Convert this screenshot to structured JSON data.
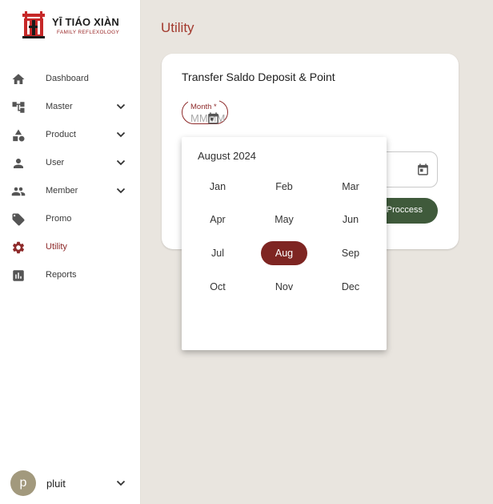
{
  "brand": {
    "name": "YĪ TIÁO XIÀN",
    "tagline": "FAMILY REFLEXOLOGY",
    "color": "#c62828"
  },
  "sidebar": {
    "items": [
      {
        "label": "Dashboard",
        "icon": "home-icon",
        "expandable": false
      },
      {
        "label": "Master",
        "icon": "hierarchy-icon",
        "expandable": true
      },
      {
        "label": "Product",
        "icon": "shapes-icon",
        "expandable": true
      },
      {
        "label": "User",
        "icon": "person-icon",
        "expandable": true
      },
      {
        "label": "Member",
        "icon": "group-icon",
        "expandable": true
      },
      {
        "label": "Promo",
        "icon": "tag-icon",
        "expandable": false
      },
      {
        "label": "Utility",
        "icon": "gear-icon",
        "expandable": false,
        "active": true
      },
      {
        "label": "Reports",
        "icon": "bar-chart-icon",
        "expandable": false
      }
    ],
    "active_color": "#8e2a2a"
  },
  "user": {
    "initial": "p",
    "name": "pluit"
  },
  "main": {
    "page_title": "Utility",
    "card_title": "Transfer Saldo Deposit & Point",
    "month_field": {
      "label": "Month *",
      "placeholder": "MMMM",
      "value": ""
    },
    "second_field": {
      "value": ""
    },
    "process_label": "Proccess",
    "process_color": "#3f5a3b"
  },
  "picker": {
    "header": "August 2024",
    "months": [
      "Jan",
      "Feb",
      "Mar",
      "Apr",
      "May",
      "Jun",
      "Jul",
      "Aug",
      "Sep",
      "Oct",
      "Nov",
      "Dec"
    ],
    "selected": "Aug",
    "selected_color": "#7e2522"
  }
}
